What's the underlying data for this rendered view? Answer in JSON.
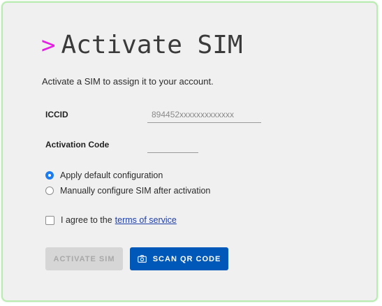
{
  "header": {
    "prompt_symbol": ">",
    "title": "Activate SIM",
    "subtitle": "Activate a SIM to assign it to your account."
  },
  "form": {
    "iccid": {
      "label": "ICCID",
      "placeholder": "894452xxxxxxxxxxxxx",
      "value": ""
    },
    "activation_code": {
      "label": "Activation Code",
      "value": ""
    },
    "configuration_options": [
      {
        "label": "Apply default configuration",
        "selected": true
      },
      {
        "label": "Manually configure SIM after activation",
        "selected": false
      }
    ],
    "terms": {
      "prefix": "I agree to the",
      "link_text": "terms of service",
      "checked": false
    }
  },
  "actions": {
    "activate_label": "ACTIVATE SIM",
    "activate_enabled": false,
    "scan_label": "SCAN QR CODE"
  },
  "colors": {
    "accent_prompt": "#e61ee6",
    "primary_button": "#0058b8",
    "radio_selected": "#1a7cf0",
    "link": "#1f3fa8",
    "card_border": "#b9ecb0"
  }
}
